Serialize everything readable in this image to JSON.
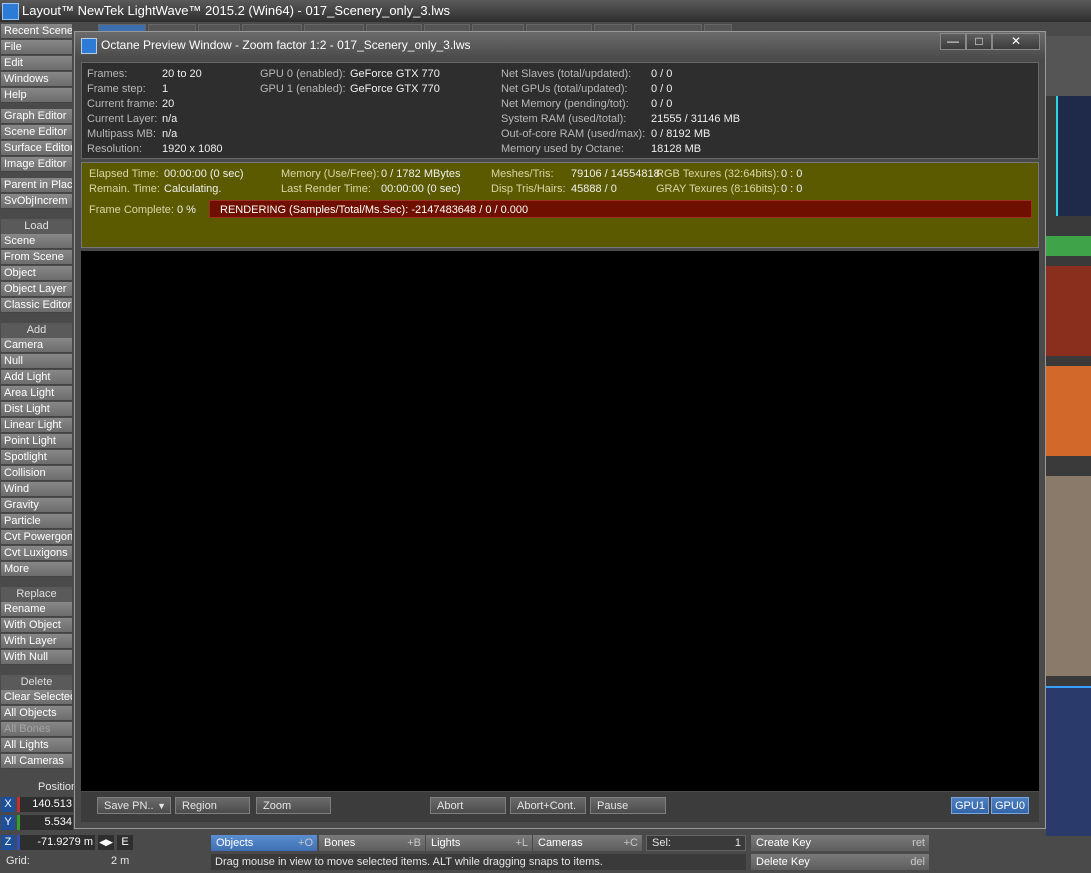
{
  "app": {
    "title": "Layout™ NewTek LightWave™ 2015.2 (Win64) - 017_Scenery_only_3.lws"
  },
  "left_toolbar": {
    "top": [
      "Recent Scene",
      "File",
      "Edit",
      "Windows",
      "Help"
    ],
    "editors": [
      "Graph Editor",
      "Scene Editor",
      "Surface Editor",
      "Image Editor"
    ],
    "misc": [
      "Parent in Place",
      "SvObjIncrem"
    ],
    "load_header": "Load",
    "load": [
      "Scene",
      "From Scene",
      "Object",
      "Object Layer",
      "Classic Editor"
    ],
    "add_header": "Add",
    "add": [
      "Camera",
      "Null",
      "Add Light",
      "Area Light",
      "Dist Light",
      "Linear Light",
      "Point Light",
      "Spotlight",
      "Collision",
      "Wind",
      "Gravity",
      "Particle",
      "Cvt Powergons",
      "Cvt Luxigons",
      "More"
    ],
    "replace_header": "Replace",
    "replace": [
      "Rename",
      "With Object",
      "With Layer",
      "With Null"
    ],
    "delete_header": "Delete",
    "delete": [
      "Clear Selected",
      "All Objects",
      "All Bones",
      "All Lights",
      "All Cameras"
    ]
  },
  "position": {
    "label": "Position",
    "x_label": "X",
    "x": "140.513",
    "y_label": "Y",
    "y": "5.534",
    "z_label": "Z",
    "z": "-71.9279 m",
    "e_label": "E",
    "grid_label": "Grid:",
    "grid": "2 m"
  },
  "octane": {
    "title": "Octane Preview Window - Zoom factor 1:2 - 017_Scenery_only_3.lws",
    "info": {
      "frames_label": "Frames:",
      "frames": "20 to 20",
      "frame_step_label": "Frame step:",
      "frame_step": "1",
      "current_frame_label": "Current frame:",
      "current_frame": "20",
      "current_layer_label": "Current Layer:",
      "current_layer": "n/a",
      "multipass_label": "Multipass MB:",
      "multipass": "n/a",
      "resolution_label": "Resolution:",
      "resolution": "1920 x 1080",
      "gpu0_label": "GPU  0 (enabled):",
      "gpu0": "GeForce GTX 770",
      "gpu1_label": "GPU  1 (enabled):",
      "gpu1": "GeForce GTX 770",
      "net_slaves_label": "Net Slaves (total/updated):",
      "net_slaves": "0 / 0",
      "net_gpus_label": "Net GPUs (total/updated):",
      "net_gpus": "0 / 0",
      "net_memory_label": "Net Memory (pending/tot):",
      "net_memory": "0 / 0",
      "system_ram_label": "System RAM (used/total):",
      "system_ram": "21555 / 31146 MB",
      "ooc_ram_label": "Out-of-core RAM (used/max):",
      "ooc_ram": "0 / 8192 MB",
      "mem_octane_label": "Memory used by Octane:",
      "mem_octane": "18128 MB"
    },
    "status": {
      "elapsed_label": "Elapsed Time:",
      "elapsed": "00:00:00 (0 sec)",
      "remain_label": "Remain. Time:",
      "remain": "Calculating.",
      "memory_label": "Memory (Use/Free):",
      "memory": "0 / 1782 MBytes",
      "last_render_label": "Last Render Time:",
      "last_render": "00:00:00 (0 sec)",
      "meshes_label": "Meshes/Tris:",
      "meshes": "79106 / 14554818",
      "disp_label": "Disp Tris/Hairs:",
      "disp": "45888 / 0",
      "rgb_label": "RGB Texures (32:64bits):",
      "rgb": "0 : 0",
      "gray_label": "GRAY Texures (8:16bits):",
      "gray": "0 : 0",
      "frame_complete_label": "Frame Complete:",
      "frame_complete": "0 %",
      "progress_text": "RENDERING (Samples/Total/Ms.Sec): -2147483648 / 0 / 0.000"
    },
    "buttons": {
      "save": "Save PN..",
      "region": "Region",
      "zoom": "Zoom",
      "abort": "Abort",
      "abort_cont": "Abort+Cont.",
      "pause": "Pause",
      "gpu1": "GPU1",
      "gpu0": "GPU0"
    }
  },
  "bottom": {
    "objects": "Objects",
    "objects_sc": "+O",
    "bones": "Bones",
    "bones_sc": "+B",
    "lights": "Lights",
    "lights_sc": "+L",
    "cameras": "Cameras",
    "cameras_sc": "+C",
    "sel_label": "Sel:",
    "sel": "1",
    "create_key": "Create Key",
    "create_key_sc": "ret",
    "delete_key": "Delete Key",
    "delete_key_sc": "del",
    "status": "Drag mouse in view to move selected items. ALT while dragging snaps to items."
  }
}
